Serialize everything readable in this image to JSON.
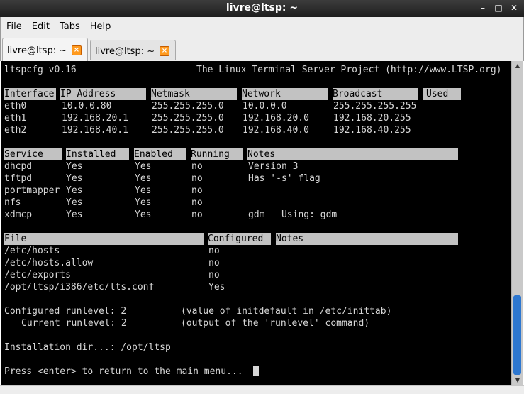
{
  "window": {
    "title": "livre@ltsp: ~",
    "buttons": [
      "–",
      "□",
      "✕"
    ]
  },
  "menu": [
    "File",
    "Edit",
    "Tabs",
    "Help"
  ],
  "tabs": [
    {
      "label": "livre@ltsp: ~",
      "active": true
    },
    {
      "label": "livre@ltsp: ~",
      "active": false
    }
  ],
  "terminal": {
    "header_left": "ltspcfg v0.16",
    "header_right": "The Linux Terminal Server Project (http://www.LTSP.org)",
    "interface_headers": [
      "Interface",
      "IP Address",
      "Netmask",
      "Network",
      "Broadcast",
      "Used"
    ],
    "interfaces": [
      [
        "eth0",
        "10.0.0.80",
        "255.255.255.0",
        "10.0.0.0",
        "255.255.255.255",
        ""
      ],
      [
        "eth1",
        "192.168.20.1",
        "255.255.255.0",
        "192.168.20.0",
        "192.168.20.255",
        ""
      ],
      [
        "eth2",
        "192.168.40.1",
        "255.255.255.0",
        "192.168.40.0",
        "192.168.40.255",
        ""
      ]
    ],
    "service_headers": [
      "Service",
      "Installed",
      "Enabled",
      "Running",
      "Notes"
    ],
    "services": [
      [
        "dhcpd",
        "Yes",
        "Yes",
        "no",
        "Version 3"
      ],
      [
        "tftpd",
        "Yes",
        "Yes",
        "no",
        "Has '-s' flag"
      ],
      [
        "portmapper",
        "Yes",
        "Yes",
        "no",
        ""
      ],
      [
        "nfs",
        "Yes",
        "Yes",
        "no",
        ""
      ],
      [
        "xdmcp",
        "Yes",
        "Yes",
        "no",
        "gdm   Using: gdm"
      ]
    ],
    "file_headers": [
      "File",
      "Configured",
      "Notes"
    ],
    "files": [
      [
        "/etc/hosts",
        "no",
        ""
      ],
      [
        "/etc/hosts.allow",
        "no",
        ""
      ],
      [
        "/etc/exports",
        "no",
        ""
      ],
      [
        "/opt/ltsp/i386/etc/lts.conf",
        "Yes",
        ""
      ]
    ],
    "runlevel_configured_label": "Configured runlevel: 2",
    "runlevel_configured_note": "(value of initdefault in /etc/inittab)",
    "runlevel_current_label": "Current runlevel: 2",
    "runlevel_current_note": "(output of the 'runlevel' command)",
    "install_dir": "Installation dir...: /opt/ltsp",
    "prompt": "Press <enter> to return to the main menu..."
  }
}
